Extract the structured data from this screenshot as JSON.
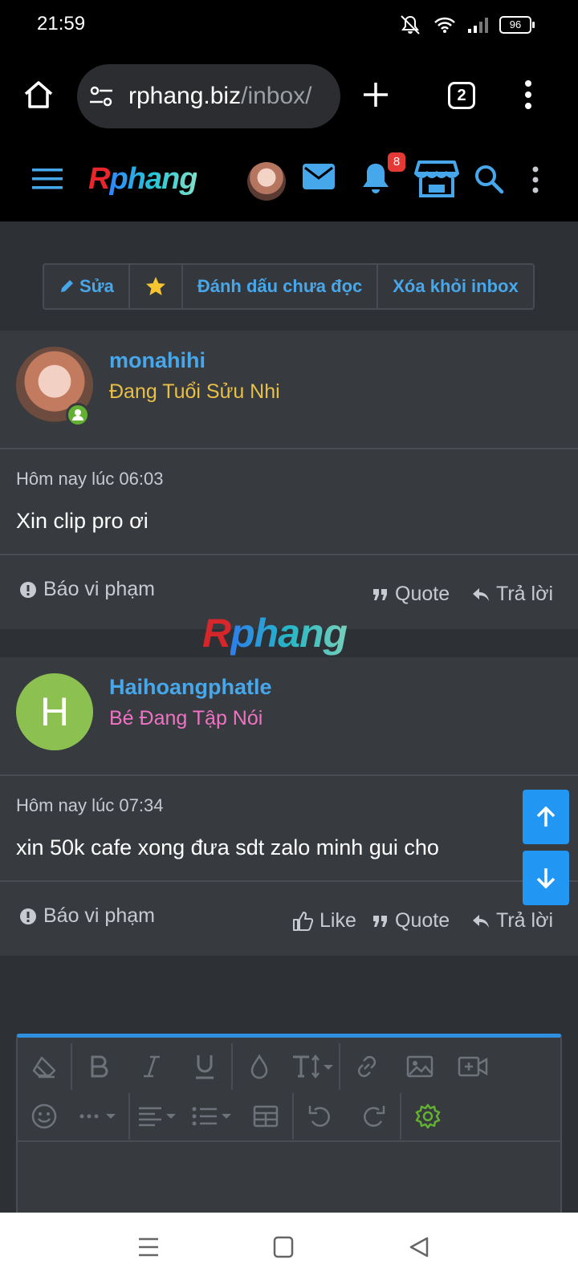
{
  "status_bar": {
    "time": "21:59",
    "battery": "96"
  },
  "browser": {
    "url_host": "rphang.biz",
    "url_path": "/inbox/",
    "tab_count": "2"
  },
  "site": {
    "logo_r": "R",
    "logo_rest": "phang",
    "notification_count": "8"
  },
  "toolbar": {
    "edit_label": "Sửa",
    "mark_unread_label": "Đánh dấu chưa đọc",
    "remove_label": "Xóa khỏi inbox"
  },
  "messages": [
    {
      "username": "monahihi",
      "user_title": "Đang Tuổi Sửu Nhi",
      "title_color": "#e8c046",
      "time": "Hôm nay lúc 06:03",
      "text": "Xin clip pro ơi",
      "report_label": "Báo vi phạm",
      "quote_label": "Quote",
      "reply_label": "Trả lời"
    },
    {
      "username": "Haihoangphatle",
      "avatar_letter": "H",
      "avatar_color": "#8cc152",
      "user_title": "Bé Đang Tập Nói",
      "title_color": "#f072c2",
      "time": "Hôm nay lúc 07:34",
      "text": "xin 50k cafe xong đưa sdt zalo minh gui cho",
      "report_label": "Báo vi phạm",
      "like_label": "Like",
      "quote_label": "Quote",
      "reply_label": "Trả lời"
    }
  ],
  "watermark": {
    "r": "R",
    "rest": "phang"
  },
  "colors": {
    "accent": "#47a7eb",
    "scroll_button": "#2196f3",
    "online": "#63b132"
  }
}
